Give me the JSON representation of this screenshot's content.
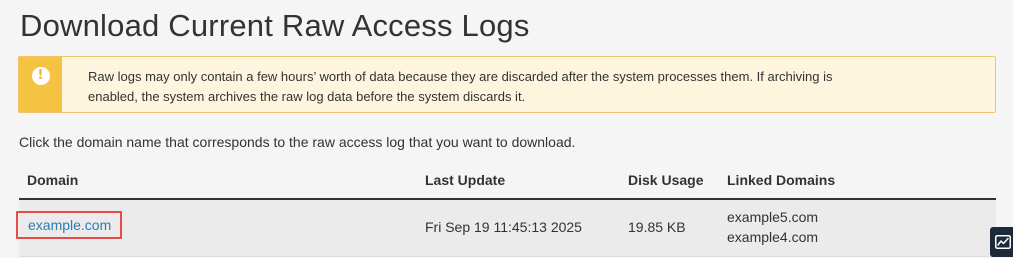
{
  "page": {
    "title": "Download Current Raw Access Logs"
  },
  "alert": {
    "icon": "warning-icon",
    "glyph": "!",
    "line1": "Raw logs may only contain a few hours’ worth of data because they are discarded after the system processes them. If archiving is",
    "line2": "enabled, the system archives the raw log data before the system discards it."
  },
  "instructions": "Click the domain name that corresponds to the raw access log that you want to download.",
  "table": {
    "headers": {
      "domain": "Domain",
      "last_update": "Last Update",
      "disk_usage": "Disk Usage",
      "linked_domains": "Linked Domains"
    },
    "rows": [
      {
        "domain": "example.com",
        "last_update": "Fri Sep 19 11:45:13 2025",
        "disk_usage": "19.85 KB",
        "linked_domains": [
          "example5.com",
          "example4.com"
        ]
      }
    ]
  },
  "widgets": {
    "chart_icon": "line-chart-icon"
  },
  "colors": {
    "alert_accent": "#f5c342",
    "alert_background": "#fdf5dd",
    "link": "#2d7bb5",
    "highlight_border": "#e64a4a",
    "widget_background": "#1e2a3a"
  }
}
